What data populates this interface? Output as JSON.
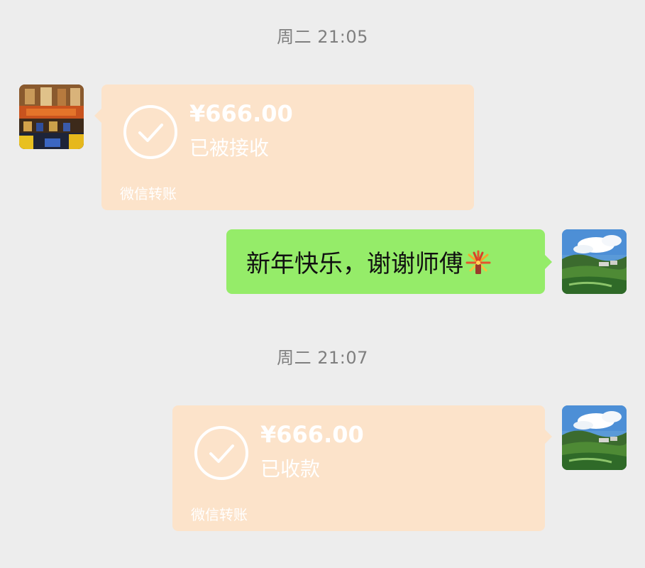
{
  "timestamps": {
    "first": "周二 21:05",
    "second": "周二 21:07"
  },
  "transfer_received": {
    "amount": "¥666.00",
    "status": "已被接收",
    "footer": "微信转账",
    "icon": "check-circle-icon",
    "card_color": "#fce3ca"
  },
  "text_message": {
    "text": "新年快乐，谢谢师傅",
    "emoji": "fireworks-icon",
    "bubble_color": "#95ec69"
  },
  "transfer_collected": {
    "amount": "¥666.00",
    "status": "已收款",
    "footer": "微信转账",
    "icon": "check-circle-icon",
    "card_color": "#fce3ca"
  },
  "avatars": {
    "sender": "temple-scene-avatar",
    "me": "landscape-avatar"
  }
}
